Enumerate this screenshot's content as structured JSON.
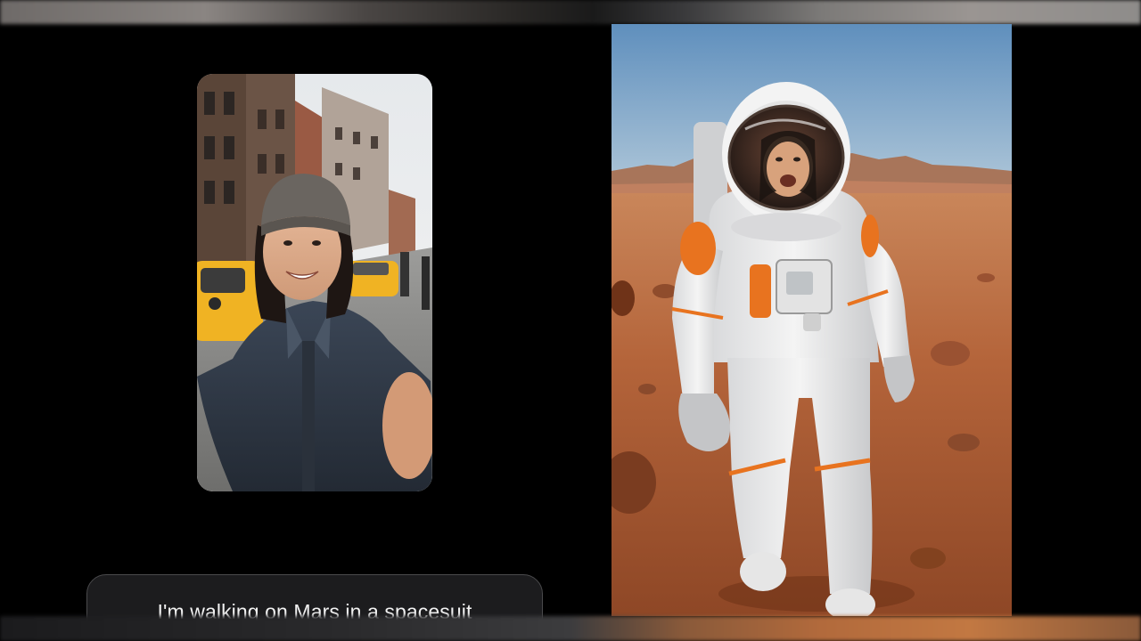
{
  "prompt": {
    "text": "I'm walking on Mars in a spacesuit"
  },
  "images": {
    "input": {
      "subject": "selfie-photo",
      "icon": "photo-icon"
    },
    "output": {
      "subject": "astronaut-on-mars",
      "icon": "photo-icon"
    }
  },
  "colors": {
    "background": "#000000",
    "prompt_box": "#1c1c1e",
    "prompt_border": "#4a4a4c",
    "mars_ground": "#b4643a",
    "sky": "#8fb2d2",
    "taxi": "#f0b323",
    "suit_orange": "#e8731f"
  }
}
